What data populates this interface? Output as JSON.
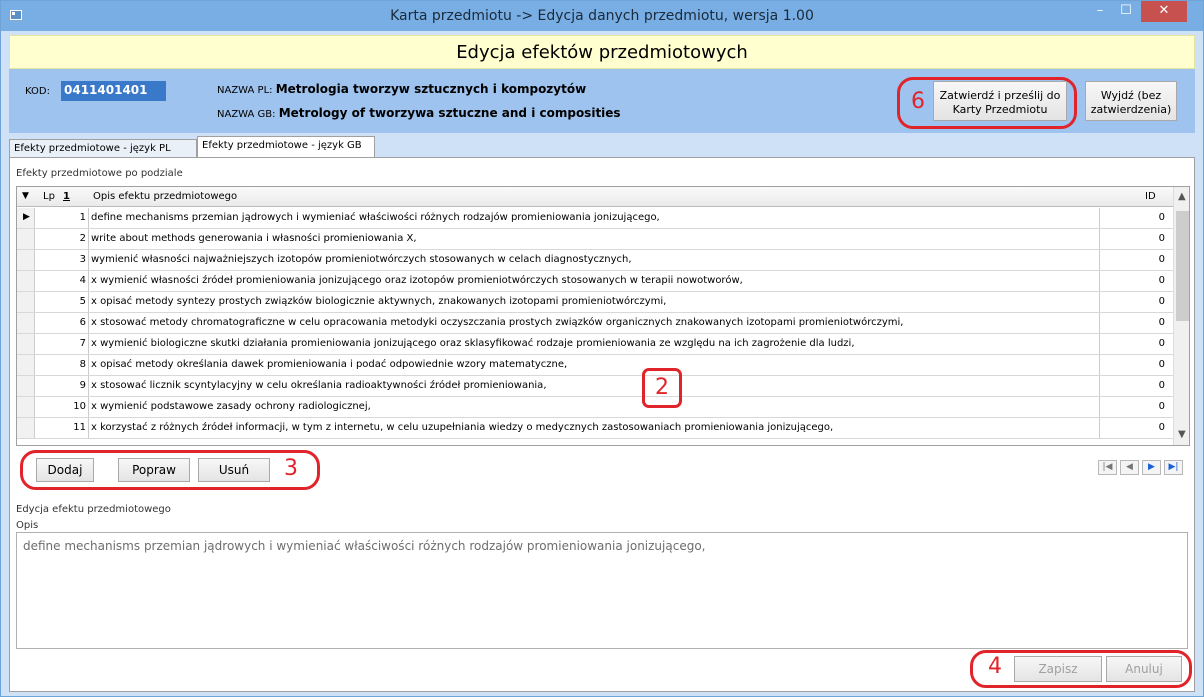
{
  "window": {
    "title": "Karta przedmiotu -> Edycja danych przedmiotu, wersja 1.00",
    "min_glyph": "–",
    "max_glyph": "☐",
    "close_glyph": "✕"
  },
  "header": {
    "subtitle": "Edycja efektów przedmiotowych",
    "kod_label": "KOD:",
    "kod_value": "0411401401",
    "nazwa_pl_label": "NAZWA PL:",
    "nazwa_pl_value": "Metrologia tworzyw sztucznych i kompozytów",
    "nazwa_gb_label": "NAZWA GB:",
    "nazwa_gb_value": "Metrology of tworzywa sztuczne and i composities",
    "approve_button": "Zatwierdź i prześlij do Karty Przedmiotu",
    "exit_button": "Wyjdź (bez zatwierdzenia)"
  },
  "tabs": [
    {
      "label": "Efekty przedmiotowe - język PL",
      "active": false
    },
    {
      "label": "Efekty przedmiotowe - język GB",
      "active": true
    }
  ],
  "grid": {
    "group_title": "Efekty przedmiotowe po podziale",
    "columns": {
      "lp": "Lp",
      "sort_indicator": "1",
      "opis": "Opis efektu przedmiotowego",
      "id": "ID"
    },
    "rows": [
      {
        "lp": "1",
        "opis": "define mechanisms  przemian jądrowych i wymieniać właściwości różnych rodzajów promieniowania jonizującego,",
        "id": "0"
      },
      {
        "lp": "2",
        "opis": "write about methods generowania i własności promieniowania X,",
        "id": "0"
      },
      {
        "lp": "3",
        "opis": "wymienić własności najważniejszych izotopów promieniotwórczych  stosowanych w celach diagnostycznych,",
        "id": "0"
      },
      {
        "lp": "4",
        "opis": "x wymienić własności źródeł promieniowania jonizującego oraz izotopów promieniotwórczych stosowanych w terapii nowotworów,",
        "id": "0"
      },
      {
        "lp": "5",
        "opis": "x opisać metody syntezy prostych związków biologicznie aktywnych, znakowanych izotopami promieniotwórczymi,",
        "id": "0"
      },
      {
        "lp": "6",
        "opis": "x stosować metody chromatograficzne w celu opracowania metodyki oczyszczania prostych związków organicznych znakowanych izotopami promieniotwórczymi,",
        "id": "0"
      },
      {
        "lp": "7",
        "opis": "x wymienić biologiczne skutki działania promieniowania jonizującego oraz sklasyfikować rodzaje promieniowania ze względu na ich zagrożenie dla ludzi,",
        "id": "0"
      },
      {
        "lp": "8",
        "opis": "x opisać metody określania dawek promieniowania i  podać odpowiednie wzory matematyczne,",
        "id": "0"
      },
      {
        "lp": "9",
        "opis": "x stosować  licznik scyntylacyjny w celu określania radioaktywności źródeł promieniowania,",
        "id": "0"
      },
      {
        "lp": "10",
        "opis": "x wymienić podstawowe zasady ochrony radiologicznej,",
        "id": "0"
      },
      {
        "lp": "11",
        "opis": "x korzystać z różnych źródeł informacji, w tym z internetu, w celu uzupełniania wiedzy o medycznych zastosowaniach promieniowania jonizującego,",
        "id": "0"
      }
    ]
  },
  "grid_buttons": {
    "add": "Dodaj",
    "edit": "Popraw",
    "delete": "Usuń"
  },
  "navigator": {
    "first": "|◀",
    "prev": "◀",
    "next": "▶",
    "last": "▶|"
  },
  "edit": {
    "group_title": "Edycja efektu przedmiotowego",
    "opis_label": "Opis",
    "opis_value": "define mechanisms  przemian jądrowych i wymieniać właściwości różnych rodzajów promieniowania jonizującego,",
    "save_button": "Zapisz",
    "cancel_button": "Anuluj"
  },
  "annotations": {
    "grid": "2",
    "grid_buttons": "3",
    "save_cancel": "4",
    "approve": "6"
  },
  "colors": {
    "title_bar": "#79aee4",
    "info_band": "#9ec3ee",
    "subtitle_bg": "#ffffd0",
    "annotation": "#e0242a"
  }
}
